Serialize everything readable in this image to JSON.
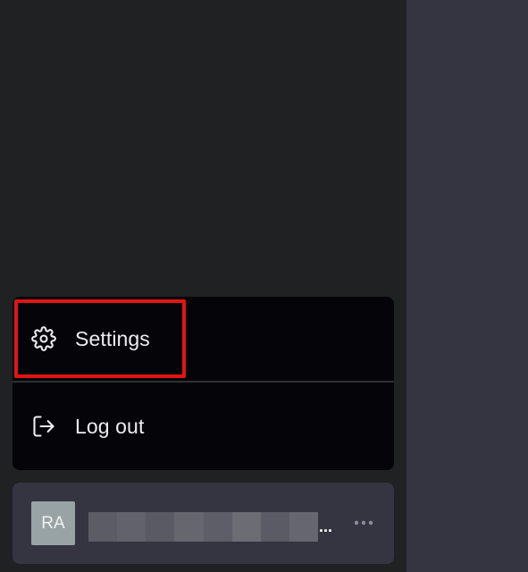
{
  "colors": {
    "sidebar_bg": "#202123",
    "main_bg": "#343541",
    "menu_bg": "#050509",
    "user_row_bg": "#343541",
    "avatar_bg": "#98a3a6",
    "highlight": "#e31414"
  },
  "menu": {
    "items": [
      {
        "label": "Settings",
        "icon": "gear-icon"
      },
      {
        "label": "Log out",
        "icon": "logout-icon"
      }
    ]
  },
  "user": {
    "initials": "RA",
    "name_ellipsis": "...",
    "name_redacted_colors": [
      "#5c5c66",
      "#62626c",
      "#5a5a64",
      "#66666f",
      "#5e5e68",
      "#6c6c74",
      "#5b5b65",
      "#666670"
    ],
    "more_icon": "more-horizontal-icon"
  }
}
